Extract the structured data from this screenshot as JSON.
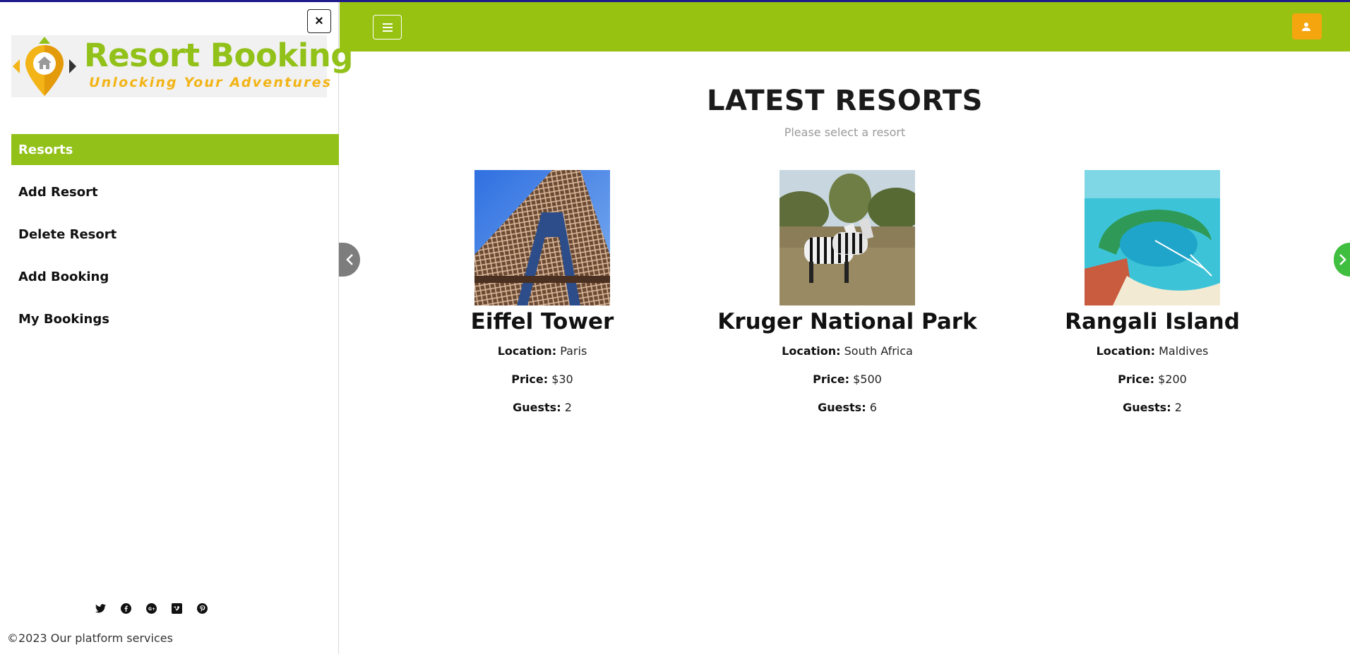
{
  "sidebar": {
    "close_label": "×",
    "logo": {
      "title": "Resort Booking",
      "subtitle": "Unlocking Your Adventures"
    },
    "nav": [
      {
        "label": "Resorts",
        "active": true
      },
      {
        "label": "Add Resort",
        "active": false
      },
      {
        "label": "Delete Resort",
        "active": false
      },
      {
        "label": "Add Booking",
        "active": false
      },
      {
        "label": "My Bookings",
        "active": false
      }
    ],
    "social_icons": [
      "twitter-icon",
      "facebook-icon",
      "google-plus-icon",
      "vimeo-icon",
      "pinterest-icon"
    ],
    "copyright": "©2023 Our platform services"
  },
  "header": {
    "accent_color": "#97c212",
    "user_button_color": "#f5a50e"
  },
  "main": {
    "title": "LATEST RESORTS",
    "subtitle": "Please select a resort",
    "labels": {
      "location": "Location:",
      "price": "Price:",
      "guests": "Guests:"
    },
    "resorts": [
      {
        "name": "Eiffel Tower",
        "location": "Paris",
        "price": "$30",
        "guests": "2"
      },
      {
        "name": "Kruger National Park",
        "location": "South Africa",
        "price": "$500",
        "guests": "6"
      },
      {
        "name": "Rangali Island",
        "location": "Maldives",
        "price": "$200",
        "guests": "2"
      }
    ]
  }
}
